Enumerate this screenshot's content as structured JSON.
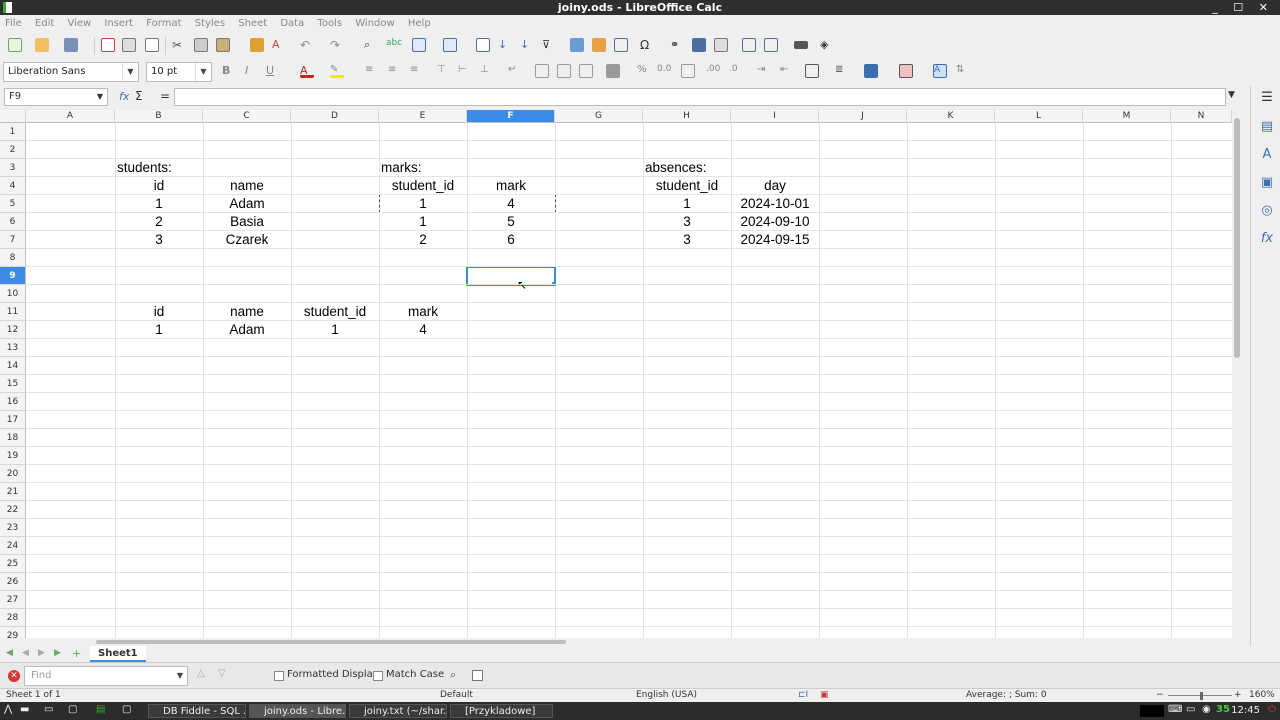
{
  "window": {
    "title": "joiny.ods - LibreOffice Calc",
    "controls": "_ ☐ ✕"
  },
  "menu": [
    "File",
    "Edit",
    "View",
    "Insert",
    "Format",
    "Styles",
    "Sheet",
    "Data",
    "Tools",
    "Window",
    "Help"
  ],
  "format_toolbar": {
    "font_name": "Liberation Sans",
    "font_size": "10 pt"
  },
  "formula_bar": {
    "name_box": "F9",
    "fx": "fx",
    "sum": "Σ",
    "equals": "=",
    "content": ""
  },
  "sheet": {
    "columns": [
      "A",
      "B",
      "C",
      "D",
      "E",
      "F",
      "G",
      "H",
      "I",
      "J",
      "K",
      "L",
      "M",
      "N"
    ],
    "rows": [
      "1",
      "2",
      "3",
      "4",
      "5",
      "6",
      "7",
      "8",
      "9",
      "10",
      "11",
      "12",
      "13",
      "14",
      "15",
      "16",
      "17",
      "18",
      "19",
      "20",
      "21",
      "22",
      "23",
      "24",
      "25",
      "26",
      "27",
      "28",
      "29"
    ],
    "selected_cell": "F9",
    "cells": {
      "B3": "students:",
      "E3": "marks:",
      "H3": "absences:",
      "B4": "id",
      "C4": "name",
      "E4": "student_id",
      "F4": "mark",
      "H4": "student_id",
      "I4": "day",
      "B5": "1",
      "C5": "Adam",
      "E5": "1",
      "F5": "4",
      "H5": "1",
      "I5": "2024-10-01",
      "B6": "2",
      "C6": "Basia",
      "E6": "1",
      "F6": "5",
      "H6": "3",
      "I6": "2024-09-10",
      "B7": "3",
      "C7": "Czarek",
      "E7": "2",
      "F7": "6",
      "H7": "3",
      "I7": "2024-09-15",
      "B11": "id",
      "C11": "name",
      "D11": "student_id",
      "E11": "mark",
      "B12": "1",
      "C12": "Adam",
      "D12": "1",
      "E12": "4"
    }
  },
  "tabs": {
    "sheet_tab": "Sheet1"
  },
  "findbar": {
    "placeholder": "Find",
    "formatted_display": "Formatted Display",
    "match_case": "Match Case"
  },
  "status": {
    "sheet_info": "Sheet 1 of 1",
    "page_style": "Default",
    "language": "English (USA)",
    "summary": "Average: ; Sum: 0",
    "zoom": "160%"
  },
  "taskbar": {
    "tasks": [
      "DB Fiddle - SQL ...",
      "joiny.ods - Libre...",
      "joiny.txt (~/shar...",
      "[Przykladowe]"
    ],
    "tray_number": "35",
    "clock": "12:45"
  }
}
